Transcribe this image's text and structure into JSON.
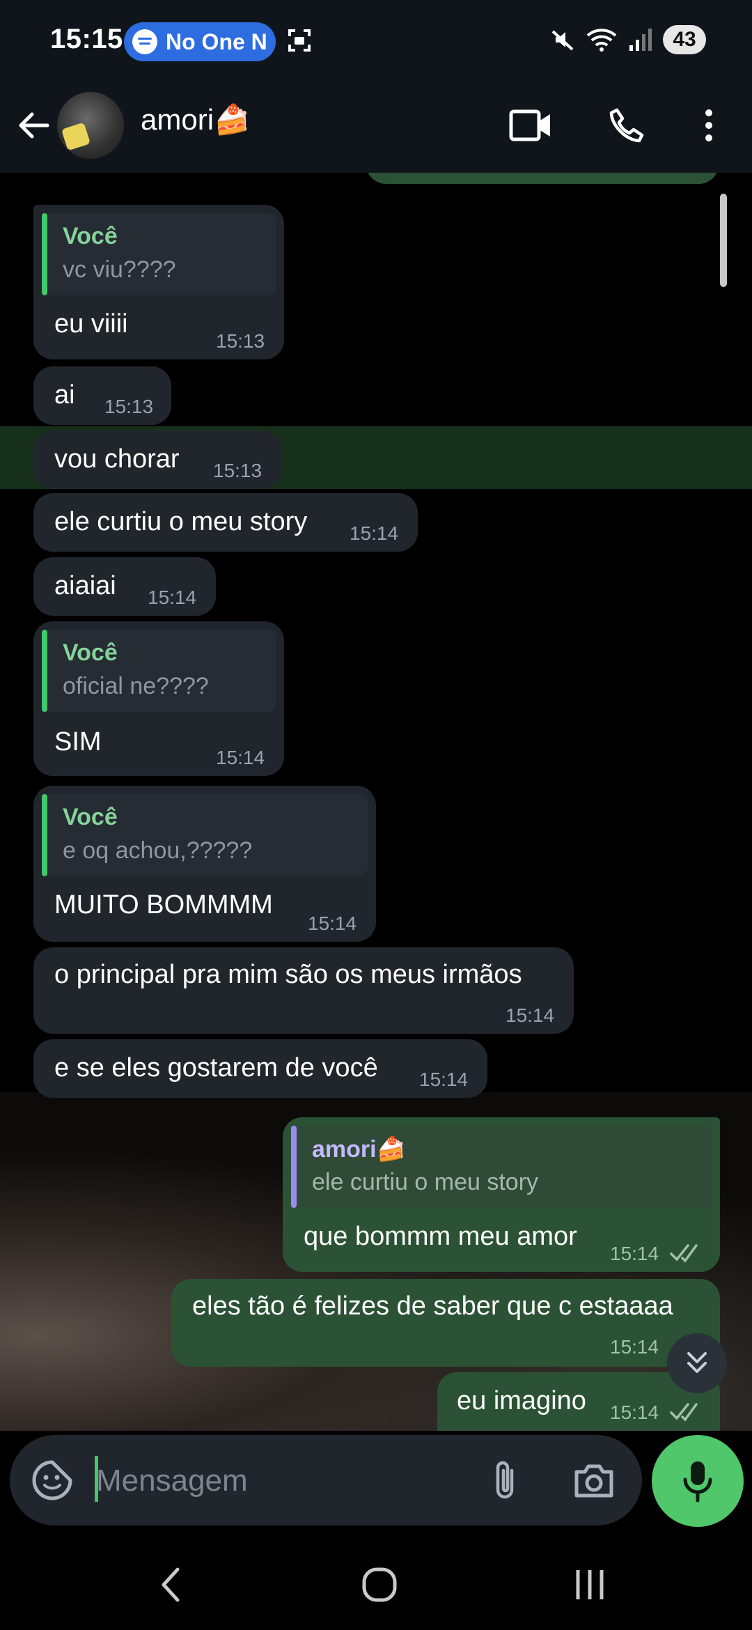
{
  "status_bar": {
    "time": "15:15",
    "now_playing": "No One N",
    "battery": "43"
  },
  "header": {
    "contact_name": "amori🍰",
    "icons": [
      "back-arrow-icon",
      "video-call-icon",
      "phone-icon",
      "more-vert-icon"
    ]
  },
  "messages": [
    {
      "dir": "in",
      "reply_name": "Você",
      "reply_text": "vc viu????",
      "text": "eu viiii",
      "time": "15:13"
    },
    {
      "dir": "in",
      "text": "ai",
      "time": "15:13"
    },
    {
      "dir": "in",
      "text": "vou chorar",
      "time": "15:13",
      "highlighted": true
    },
    {
      "dir": "in",
      "text": "ele curtiu o meu story",
      "time": "15:14"
    },
    {
      "dir": "in",
      "text": "aiaiai",
      "time": "15:14"
    },
    {
      "dir": "in",
      "reply_name": "Você",
      "reply_text": "oficial ne????",
      "text": "SIM",
      "time": "15:14"
    },
    {
      "dir": "in",
      "reply_name": "Você",
      "reply_text": "e oq achou,?????",
      "text": "MUITO BOMMMM",
      "time": "15:14"
    },
    {
      "dir": "in",
      "text": "o principal pra mim são os meus irmãos",
      "time": "15:14"
    },
    {
      "dir": "in",
      "text": "e se eles gostarem de você",
      "time": "15:14"
    },
    {
      "dir": "out",
      "reply_name": "amori🍰",
      "reply_text": "ele curtiu o meu story",
      "text": "que bommm meu amor",
      "time": "15:14",
      "read": true
    },
    {
      "dir": "out",
      "text": "eles tão é felizes de saber que c estaaaa",
      "time": "15:14"
    },
    {
      "dir": "out",
      "text": "eu imagino",
      "time": "15:14",
      "read": true
    }
  ],
  "composer": {
    "placeholder": "Mensagem"
  },
  "colors": {
    "incoming": "#21262d",
    "outgoing": "#2b5234",
    "accent": "#4fc76a",
    "reply_in_bar": "#43c969",
    "reply_out_bar": "#9a8cf0"
  }
}
